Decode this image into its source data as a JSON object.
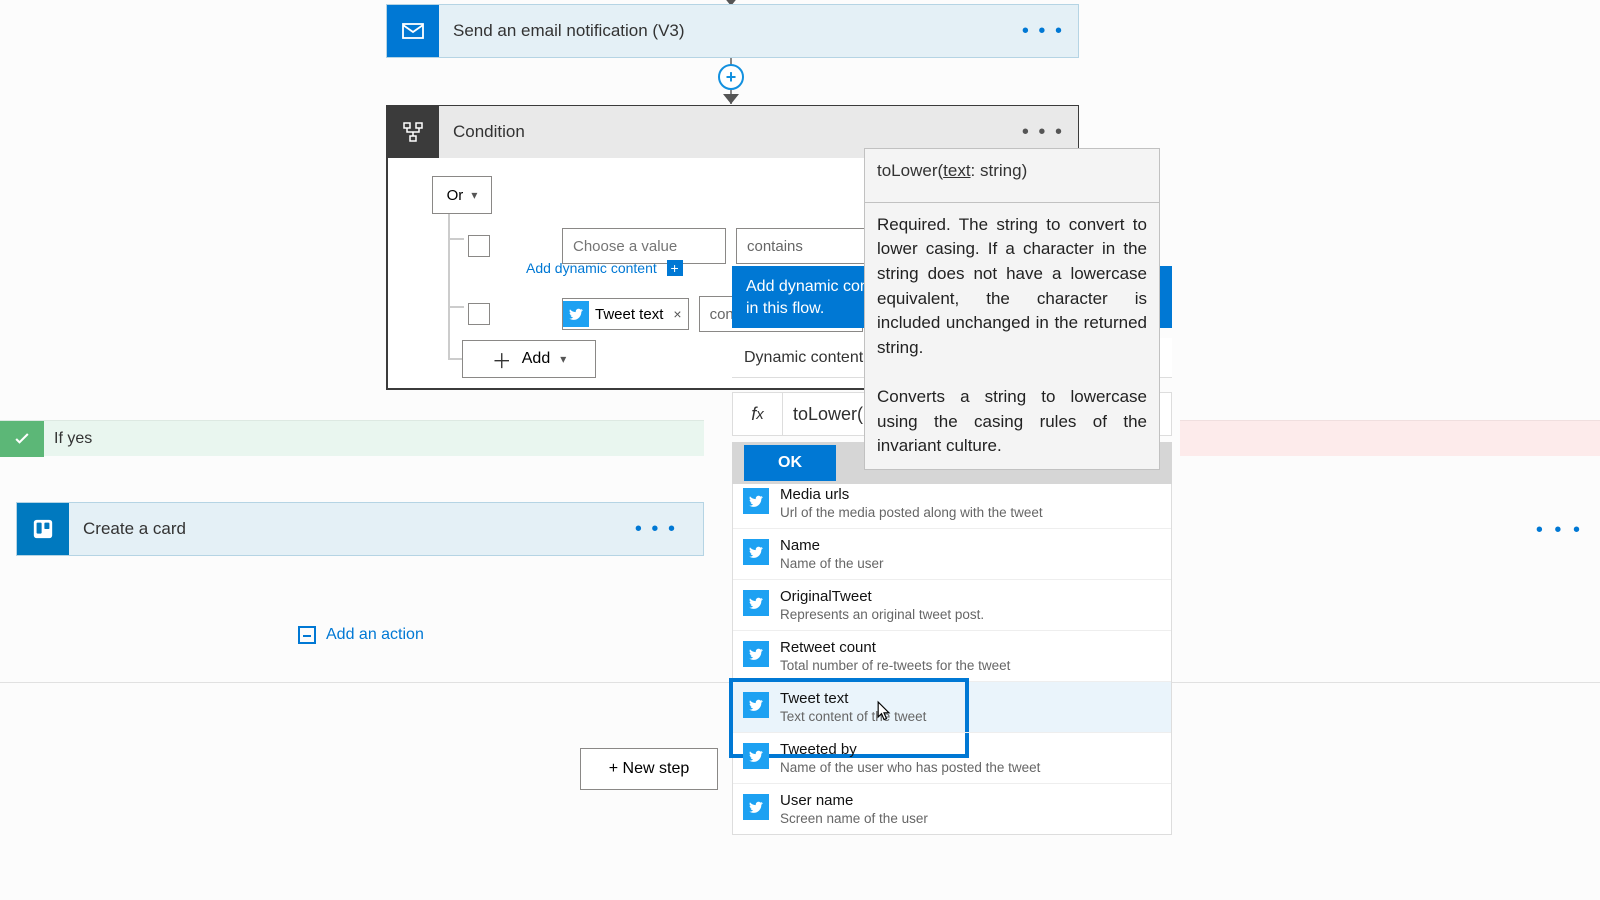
{
  "steps": {
    "email": {
      "title": "Send an email notification (V3)"
    },
    "condition": {
      "title": "Condition",
      "group": "Or",
      "add": "Add"
    },
    "card": {
      "title": "Create a card"
    }
  },
  "rows": {
    "r1": {
      "placeholder": "Choose a value",
      "op": "contains",
      "add_dynamic": "Add dynamic content"
    },
    "r2": {
      "token": "Tweet text",
      "token_close": "×",
      "op": "contains"
    }
  },
  "branches": {
    "yes": "If yes"
  },
  "add_action": "Add an action",
  "new_step": "+ New step",
  "dynamic": {
    "banner": "Add dynamic content from the apps and connectors used in this flow.",
    "tab": "Dynamic content",
    "fx": "toLower(",
    "ok": "OK",
    "items": [
      {
        "title": "Media urls",
        "desc": "Url of the media posted along with the tweet"
      },
      {
        "title": "Name",
        "desc": "Name of the user"
      },
      {
        "title": "OriginalTweet",
        "desc": "Represents an original tweet post."
      },
      {
        "title": "Retweet count",
        "desc": "Total number of re-tweets for the tweet"
      },
      {
        "title": "Tweet text",
        "desc": "Text content of the tweet"
      },
      {
        "title": "Tweeted by",
        "desc": "Name of the user who has posted the tweet"
      },
      {
        "title": "User name",
        "desc": "Screen name of the user"
      }
    ]
  },
  "tooltip": {
    "signature": "toLower(text: string)",
    "sig_fn": "toLower(",
    "sig_param": "text",
    "sig_tail": ": string)",
    "desc": "Required. The string to convert to lower casing. If a character in the string does not have a lowercase equivalent, the character is included unchanged in the returned string.",
    "conv": "Converts a string to lowercase using the casing rules of the invariant culture."
  }
}
